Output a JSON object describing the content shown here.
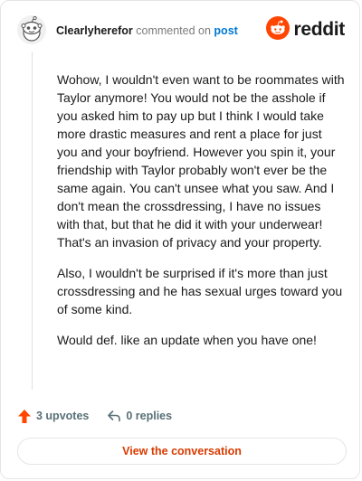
{
  "comment": {
    "author": "Clearlyherefor",
    "action_text": "commented on",
    "post_link_label": "post",
    "paragraphs": [
      "Wohow, I wouldn't even want to be roommates with Taylor anymore! You would not be the asshole if you asked him to pay up but I think I would take more drastic measures and rent a place for just you and your boyfriend. However you spin it, your friendship with Taylor probably won't ever be the same again. You can't unsee what you saw. And I don't mean the crossdressing, I have no issues with that, but that he did it with your underwear! That's an invasion of privacy and your property.",
      "Also, I wouldn't be surprised if it's more than just crossdressing and he has sexual urges toward you of some kind.",
      "Would def. like an update when you have one!"
    ],
    "upvotes_label": "3 upvotes",
    "replies_label": "0 replies",
    "view_button_label": "View the conversation"
  },
  "brand": {
    "name": "reddit",
    "accent_color": "#ff4500",
    "link_color": "#0079d3"
  },
  "icons": {
    "avatar": "snoo-avatar-icon",
    "logo": "reddit-logo-icon",
    "upvote": "upvote-arrow-icon",
    "reply": "reply-arrow-icon"
  }
}
